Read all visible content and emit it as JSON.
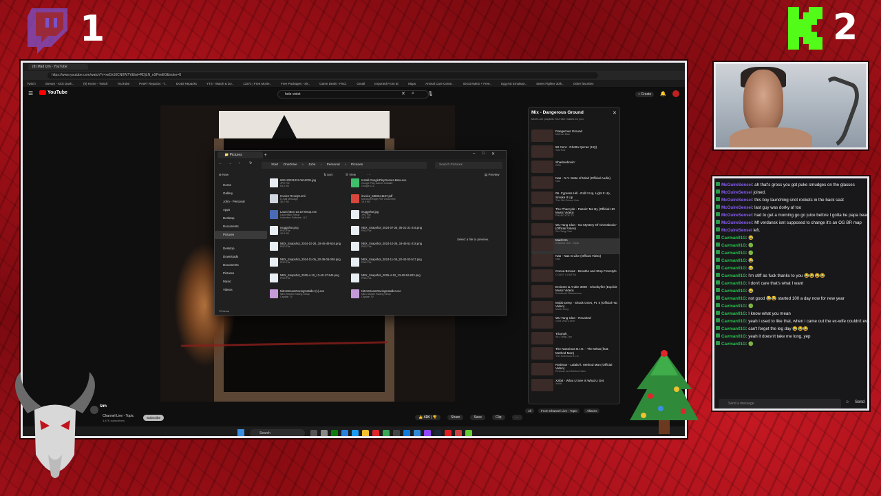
{
  "overlay": {
    "left_number": "1",
    "right_number": "2"
  },
  "browser": {
    "tab_title": "(8) Mad Izm - YouTube",
    "url": "https://www.youtube.com/watch?v=xeDx16CN0W7Y&list=RDjLN_nSPeeE0&index=8",
    "bookmarks": [
      "Twitch",
      "Stream - Kick Dash..",
      "(9) Home - Twitch",
      "YouTube",
      "PAWT Repacks - T..",
      "DODI Repacks",
      "YTS - Watch & Do..",
      "1337x | Free Movie..",
      "Free Packages - Sk..",
      "Game Deals - Find..",
      "Gmail",
      "Imported From IE",
      "Maps",
      "Animal Care Cente..",
      "IGGGAMES + Free..",
      "Egg NS Emulator..",
      "Street Fighter 30th..",
      "Other favorites"
    ]
  },
  "youtube": {
    "logo": "YouTube",
    "search_value": "hole violet",
    "channel_name": "Channel Live - Topic",
    "subscribers": "4.47K subscribers",
    "video_title": "Izm",
    "subscribe_label": "Subscribe",
    "likes": "41K",
    "share_label": "Share",
    "save_label": "Save",
    "clip_label": "Clip",
    "create_label": "Create",
    "playlist": {
      "title": "Mix - Dangerous Ground",
      "subtitle": "Mixes are playlists YouTube makes for you",
      "items": [
        {
          "title": "Dangerous Ground",
          "artist": "Method Man"
        },
        {
          "title": "50 Cent - Ghetto Qu'ran (HQ)",
          "artist": "StarTrak"
        },
        {
          "title": "Shadowboxin'",
          "artist": "GZA"
        },
        {
          "title": "Nas - N.Y. State of Mind (Official Audio)",
          "artist": "Nas"
        },
        {
          "title": "06. Cypress Hill - Roll It Up, Light It Up, Smoke It Up",
          "artist": "The Old School Hub"
        },
        {
          "title": "The Pharcyde - Passin' Me By (Official HD Music Video)",
          "artist": "PHARCYDE TV"
        },
        {
          "title": "Wu-Tang Clan - Da Mystery Of Chessboxin' (Official Video)",
          "artist": "Wu-Tang Clan"
        },
        {
          "title": "Mad Izm",
          "artist": "Channel Live - Topic"
        },
        {
          "title": "Nas - Nas Is Like (Official Video)",
          "artist": "Nas"
        },
        {
          "title": "Cocoa Brovaz - Breathe and Stop Freestyle",
          "artist": "COAST CONTRA"
        },
        {
          "title": "Eminem & Andre 3000 - Chonkyfire (Explicit Music Video)",
          "artist": "Emotional Obsessions"
        },
        {
          "title": "Mobb Deep - Shook Ones, Pt. II (Official HD Video)",
          "artist": "Mobb Deep"
        },
        {
          "title": "Wu-Tang Clan - Reunited",
          "artist": "Gold Vida y Dice"
        },
        {
          "title": "Triumph",
          "artist": "Wu-Tang Clan"
        },
        {
          "title": "The Notorious B.I.G. - The What (feat. Method Man)",
          "artist": "The Notorious B.I.G."
        },
        {
          "title": "Redman - Lalala ft. Method Man (Official Video)",
          "artist": "Redman and Method Man"
        },
        {
          "title": "Xzibit - What U See Is What U Get",
          "artist": "Xzibit"
        }
      ]
    },
    "chips": [
      "All",
      "From Channel Live - Topic",
      "Albums"
    ]
  },
  "explorer": {
    "window_title": "Pictures",
    "breadcrumb": [
      "Start OneDrive",
      "John - Personal",
      "Pictures"
    ],
    "search_placeholder": "Search Pictures",
    "toolbar": {
      "new": "New",
      "sort": "Sort",
      "view": "View",
      "preview": "Preview"
    },
    "sidebar": [
      "Home",
      "Gallery",
      "John - Personal",
      "Apps",
      "Desktop",
      "Documents",
      "Pictures",
      "Desktop",
      "Downloads",
      "Documents",
      "Pictures",
      "Music",
      "Videos"
    ],
    "files": [
      {
        "name": "IMG-20231223-WA0001.jpg",
        "type": "JPG File",
        "size": "63.0 KB",
        "icon": "image-icon"
      },
      {
        "name": "Install-GooglePlayGames-Beta.exe",
        "type": "Google Play Games Installer",
        "size": "Google LLC",
        "icon": "gplay-icon"
      },
      {
        "name": "Invoice Receipt.eml",
        "type": "E-mail Message",
        "size": "36.2 KB",
        "icon": "mail-icon"
      },
      {
        "name": "invoice_5883141197.pdf",
        "type": "Microsoft Edge PDF Document",
        "size": "15.6 KB",
        "icon": "pdf-icon"
      },
      {
        "name": "LaunchBox-13.10-Setup.exe",
        "type": "LaunchBox Setup",
        "size": "Unbroken Software, LLC",
        "icon": "app-icon"
      },
      {
        "name": "muggshot.jpg",
        "type": "JPG File",
        "size": "16.5 KB",
        "icon": "image-icon"
      },
      {
        "name": "muggshot.png",
        "type": "PNG File",
        "size": "16.5 KB",
        "icon": "image-icon"
      },
      {
        "name": "NBX_Snapshot_2024-07-25_06-21-21-216.png",
        "type": "PNG File",
        "size": "",
        "icon": "image-icon"
      },
      {
        "name": "NBX_Snapshot_2024-10-26_19-45-49-516.png",
        "type": "PNG File",
        "size": "",
        "icon": "image-icon"
      },
      {
        "name": "NBX_Snapshot_2024-10-26_19-45-51-218.png",
        "type": "PNG File",
        "size": "",
        "icon": "image-icon"
      },
      {
        "name": "NBX_Snapshot_2024-11-05_20-39-06-008.png",
        "type": "PNG File",
        "size": "",
        "icon": "image-icon"
      },
      {
        "name": "NBX_Snapshot_2024-11-05_20-40-03-517.png",
        "type": "PNG File",
        "size": "",
        "icon": "image-icon"
      },
      {
        "name": "NBX_Snapshot_2025-4-10_13-40-17-544.png",
        "type": "PNG File",
        "size": "",
        "icon": "image-icon"
      },
      {
        "name": "NBX_Snapshot_2025-4-10_13-40-52-823.png",
        "type": "PNG File",
        "size": "",
        "icon": "image-icon"
      },
      {
        "name": "NitroStreamRacingInstaller (1).exe",
        "type": "Nitro Stream Racing Setup",
        "size": "Captain TV",
        "icon": "nitro-icon"
      },
      {
        "name": "NitroStreamRacingInstaller.exe",
        "type": "Nitro Stream Racing Setup",
        "size": "Captain TV",
        "icon": "nitro-icon"
      }
    ],
    "preview_hint": "Select a file to preview.",
    "status": "70 items"
  },
  "taskbar": {
    "search_label": "Search"
  },
  "chat": {
    "lines": [
      {
        "user": "McGuireSensei",
        "text": ": ah that's gross you got puke smudges on the glasses",
        "cls": "user"
      },
      {
        "user": "McGuireSensei",
        "text": " joined.",
        "cls": "user"
      },
      {
        "user": "McGuireSensei",
        "text": ": this boy launching snot rockets in the back seat",
        "cls": "user"
      },
      {
        "user": "McGuireSensei",
        "text": ": last guy was dorky af too",
        "cls": "user"
      },
      {
        "user": "McGuireSensei",
        "text": ": had to get a morning go go juice before I gotta be papa bear at the hospital",
        "cls": "user"
      },
      {
        "user": "McGuireSensei",
        "text": ": Mf verdansk isnt supposed to change it's an OG BR map",
        "cls": "user"
      },
      {
        "user": "McGuireSensei",
        "text": " left.",
        "cls": "user"
      },
      {
        "user": "Cavman01G",
        "text": ": 😂",
        "cls": "user2"
      },
      {
        "user": "Cavman01G",
        "text": ": 🟢",
        "cls": "user2"
      },
      {
        "user": "Cavman01G",
        "text": ": 🟢",
        "cls": "user2"
      },
      {
        "user": "Cavman01G",
        "text": ": 😂",
        "cls": "user2"
      },
      {
        "user": "Cavman01G",
        "text": ": 😂",
        "cls": "user2"
      },
      {
        "user": "Cavman01G",
        "text": ": I'm stiff as fuck thanks to you 😂😂😂😂",
        "cls": "user2"
      },
      {
        "user": "Cavman01G",
        "text": ": I don't care that's what I want",
        "cls": "user2"
      },
      {
        "user": "Cavman01G",
        "text": ": 😂",
        "cls": "user2"
      },
      {
        "user": "Cavman01G",
        "text": ": not good 😂😂 started 100 a day now for new year",
        "cls": "user2"
      },
      {
        "user": "Cavman01G",
        "text": ": 🟢",
        "cls": "user2"
      },
      {
        "user": "Cavman01G",
        "text": ": I know what you mean",
        "cls": "user2"
      },
      {
        "user": "Cavman01G",
        "text": ": yeah i used to like that, when i came out the ex-wife couldn't even get her arms around me",
        "cls": "user2"
      },
      {
        "user": "Cavman01G",
        "text": ": can't forget the leg day 😂😂😂",
        "cls": "user2"
      },
      {
        "user": "Cavman01G",
        "text": ": yeah it doesn't take me long, yep",
        "cls": "user2"
      },
      {
        "user": "Cavman01G",
        "text": ": 🟢",
        "cls": "user2"
      }
    ],
    "input_placeholder": "Send a message",
    "send_label": "Send"
  }
}
